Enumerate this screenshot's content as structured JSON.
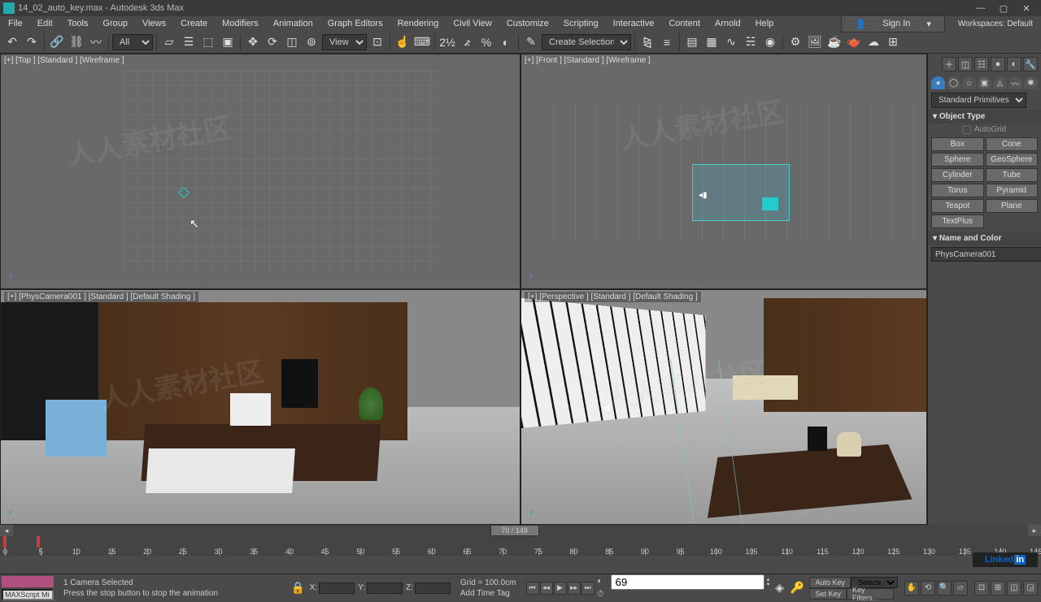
{
  "title": "14_02_auto_key.max - Autodesk 3ds Max",
  "menus": [
    "File",
    "Edit",
    "Tools",
    "Group",
    "Views",
    "Create",
    "Modifiers",
    "Animation",
    "Graph Editors",
    "Rendering",
    "Civil View",
    "Customize",
    "Scripting",
    "Interactive",
    "Content",
    "Arnold",
    "Help"
  ],
  "signin": "Sign In",
  "workspace": "Workspaces: Default",
  "toolbar": {
    "all_dd": "All",
    "view_dd": "View",
    "sel_dd": "Create Selection Se"
  },
  "viewports": {
    "top": "[+] [Top ] [Standard ] [Wireframe ]",
    "front": "[+] [Front ] [Standard ] [Wireframe ]",
    "camera": "[+] [PhysCamera001 ] [Standard ] [Default Shading ]",
    "persp": "[+] [Perspective ] [Standard ] [Default Shading ]"
  },
  "cmd": {
    "primitives_dd": "Standard Primitives",
    "object_type_hdr": "Object Type",
    "autogrid": "AutoGrid",
    "buttons": [
      [
        "Box",
        "Cone"
      ],
      [
        "Sphere",
        "GeoSphere"
      ],
      [
        "Cylinder",
        "Tube"
      ],
      [
        "Torus",
        "Pyramid"
      ],
      [
        "Teapot",
        "Plane"
      ],
      [
        "TextPlus",
        ""
      ]
    ],
    "name_color_hdr": "Name and Color",
    "obj_name": "PhysCamera001"
  },
  "timeline": {
    "handle": "70 / 149",
    "ticks": [
      "0",
      "5",
      "10",
      "15",
      "20",
      "25",
      "30",
      "35",
      "40",
      "45",
      "50",
      "55",
      "60",
      "65",
      "70",
      "75",
      "80",
      "85",
      "90",
      "95",
      "100",
      "105",
      "110",
      "115",
      "120",
      "125",
      "130",
      "135",
      "140",
      "145"
    ]
  },
  "status": {
    "mini": "MAXScript Mi",
    "line1": "1 Camera Selected",
    "line2": "Press the stop button to stop the animation",
    "xl": "X:",
    "yl": "Y:",
    "zl": "Z:",
    "grid": "Grid = 100.0cm",
    "addtime": "Add Time Tag",
    "frame": "69",
    "autokey": "Auto Key",
    "setkey": "Set Key",
    "selected": "Selected",
    "keyfilters": "Key Filters..."
  }
}
